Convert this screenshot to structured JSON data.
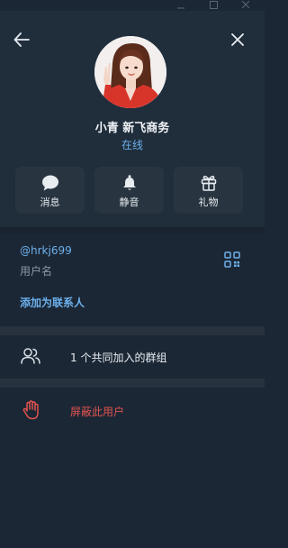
{
  "window": {
    "controls": [
      "minimize-icon",
      "maximize-icon",
      "close-icon"
    ]
  },
  "header": {
    "back_icon": "arrow-left-icon",
    "close_icon": "close-icon",
    "name": "小青 新飞商务",
    "status": "在线"
  },
  "actions": [
    {
      "label": "消息",
      "icon": "message-bubble-icon"
    },
    {
      "label": "静音",
      "icon": "bell-icon"
    },
    {
      "label": "礼物",
      "icon": "gift-icon"
    }
  ],
  "info": {
    "username": "@hrkj699",
    "username_label": "用户名",
    "qr_icon": "qr-code-icon",
    "add_contact": "添加为联系人"
  },
  "groups": {
    "text": "1 个共同加入的群组",
    "icon": "users-icon"
  },
  "block": {
    "text": "屏蔽此用户",
    "icon": "hand-stop-icon"
  },
  "colors": {
    "background": "#1c2735",
    "header_bg": "#202d3b",
    "accent": "#6cb0ec",
    "danger": "#e1534f",
    "separator": "#28323e"
  }
}
